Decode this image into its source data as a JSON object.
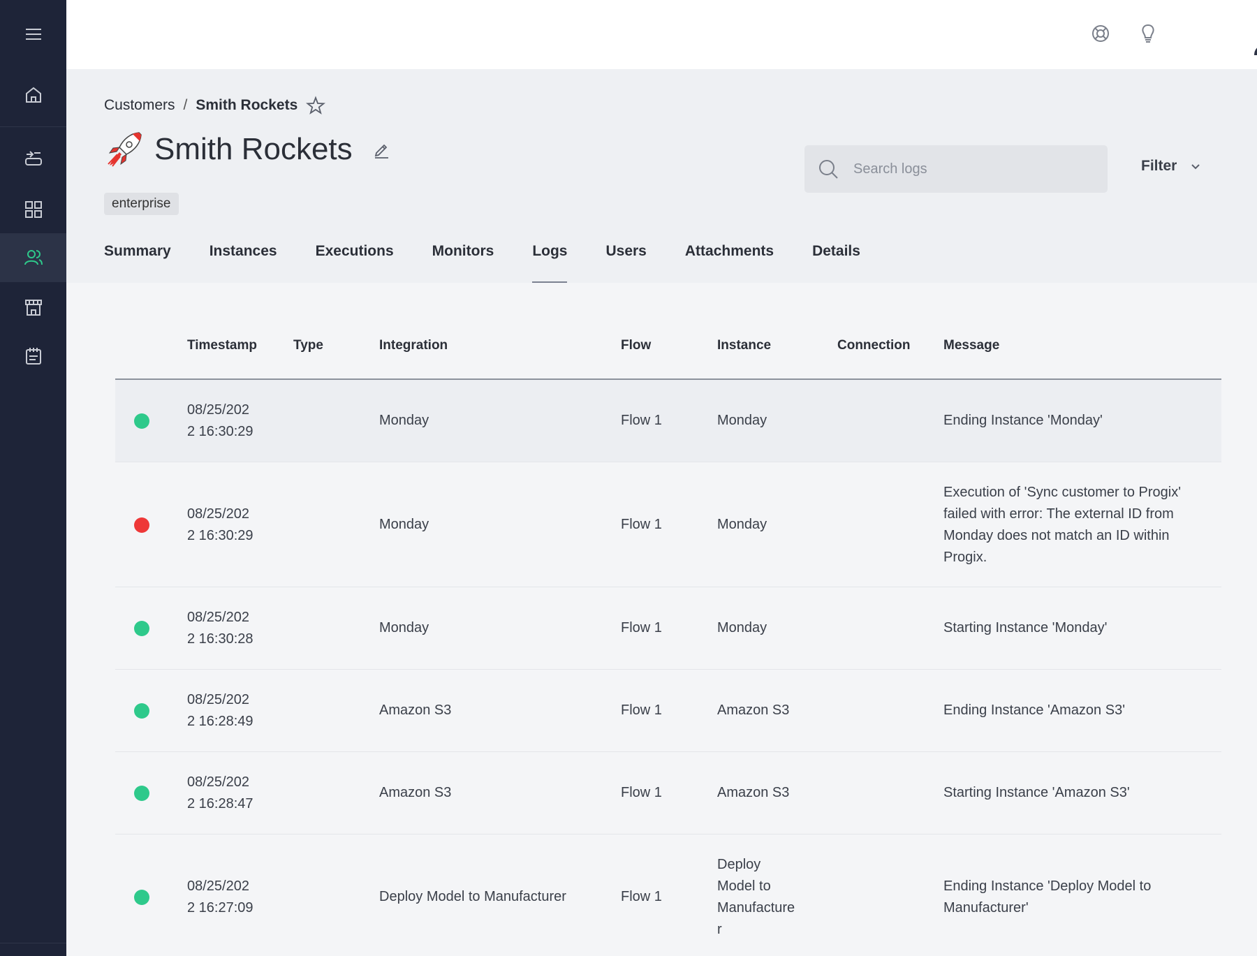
{
  "topbar": {
    "help_icon": "lifebuoy-icon",
    "ideas_icon": "lightbulb-icon",
    "avatar_icon": "user-avatar"
  },
  "sidebar": {
    "items": [
      {
        "icon": "menu-icon"
      },
      {
        "icon": "home-icon"
      },
      {
        "icon": "integrations-icon"
      },
      {
        "icon": "components-grid-icon"
      },
      {
        "icon": "customers-icon",
        "active": true
      },
      {
        "icon": "marketplace-store-icon"
      },
      {
        "icon": "logs-notepad-icon"
      }
    ]
  },
  "breadcrumb": {
    "parent": "Customers",
    "separator": "/",
    "current": "Smith Rockets"
  },
  "page": {
    "title": "Smith Rockets",
    "tag": "enterprise"
  },
  "search": {
    "placeholder": "Search logs"
  },
  "filter": {
    "label": "Filter"
  },
  "tabs": [
    {
      "label": "Summary"
    },
    {
      "label": "Instances"
    },
    {
      "label": "Executions"
    },
    {
      "label": "Monitors"
    },
    {
      "label": "Logs",
      "active": true
    },
    {
      "label": "Users"
    },
    {
      "label": "Attachments"
    },
    {
      "label": "Details"
    }
  ],
  "table": {
    "headers": {
      "timestamp": "Timestamp",
      "type": "Type",
      "integration": "Integration",
      "flow": "Flow",
      "instance": "Instance",
      "connection": "Connection",
      "message": "Message"
    },
    "rows": [
      {
        "status": "success",
        "ts1": "08/25/202",
        "ts2": "2 16:30:29",
        "integration": "Monday",
        "flow": "Flow 1",
        "instance": [
          "Monday"
        ],
        "message": [
          "Ending Instance 'Monday'"
        ]
      },
      {
        "status": "error",
        "ts1": "08/25/202",
        "ts2": "2 16:30:29",
        "integration": "Monday",
        "flow": "Flow 1",
        "instance": [
          "Monday"
        ],
        "message": [
          "Execution of 'Sync customer to Progix'",
          "failed with error: The external ID from",
          "Monday does not match an ID within",
          "Progix."
        ]
      },
      {
        "status": "success",
        "ts1": "08/25/202",
        "ts2": "2 16:30:28",
        "integration": "Monday",
        "flow": "Flow 1",
        "instance": [
          "Monday"
        ],
        "message": [
          "Starting Instance 'Monday'"
        ]
      },
      {
        "status": "success",
        "ts1": "08/25/202",
        "ts2": "2 16:28:49",
        "integration": "Amazon S3",
        "flow": "Flow 1",
        "instance": [
          "Amazon S3"
        ],
        "message": [
          "Ending Instance 'Amazon S3'"
        ]
      },
      {
        "status": "success",
        "ts1": "08/25/202",
        "ts2": "2 16:28:47",
        "integration": "Amazon S3",
        "flow": "Flow 1",
        "instance": [
          "Amazon S3"
        ],
        "message": [
          "Starting Instance 'Amazon S3'"
        ]
      },
      {
        "status": "success",
        "ts1": "08/25/202",
        "ts2": "2 16:27:09",
        "integration": "Deploy Model to Manufacturer",
        "flow": "Flow 1",
        "instance": [
          "Deploy",
          "Model to",
          "Manufacture",
          "r"
        ],
        "message": [
          "Ending Instance 'Deploy Model to",
          "Manufacturer'"
        ]
      }
    ]
  },
  "colors": {
    "sidebar_bg": "#1e2438",
    "accent_green": "#2ec98b",
    "error_red": "#ee3838"
  }
}
